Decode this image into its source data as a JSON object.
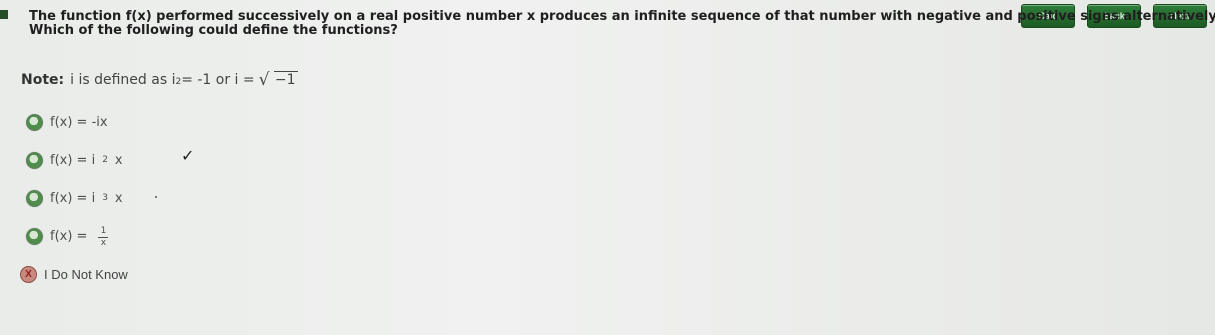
{
  "toolbar": {
    "calc_label": "Calc",
    "back_label": "Back",
    "next_label": "Next"
  },
  "question": {
    "line1": "The function f(x) performed successively on a real positive number x produces an infinite sequence of that number with negative and positive signs alternatively.",
    "line2": "Which of the following could define the functions?"
  },
  "note": {
    "label": "Note:",
    "text_before_sup": "i is defined as i",
    "sup": "2",
    "text_after_sup": "= -1 or i =",
    "sqrt_inner": "−1"
  },
  "answers": [
    {
      "prefix": "f(x) = -ix"
    },
    {
      "prefix": "f(x) = i",
      "exponent": "2",
      "suffix": "x"
    },
    {
      "prefix": "f(x) = i",
      "exponent": "3",
      "suffix": "x"
    },
    {
      "prefix": "f(x) =",
      "numerator": "1",
      "denominator": "x"
    }
  ],
  "dont_know": {
    "icon_text": "X",
    "label": "I Do Not Know"
  },
  "marks": {
    "correct_check": "✓"
  },
  "colors": {
    "nav_button": "#2f7e39",
    "radio_green": "#4f8d4b",
    "dont_know_red": "#c9897f"
  }
}
